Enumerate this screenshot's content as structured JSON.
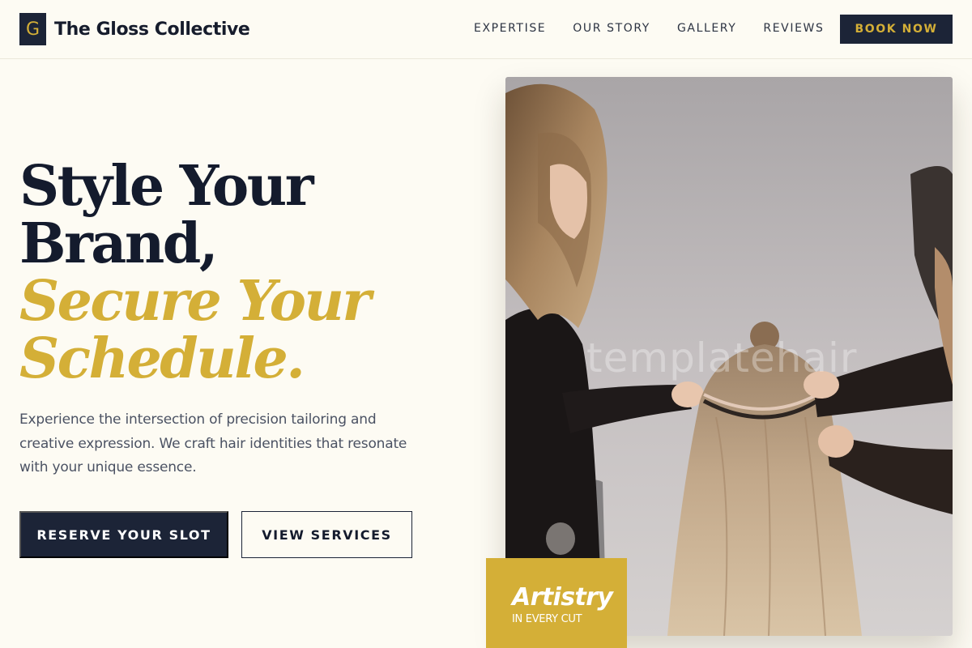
{
  "brand": {
    "logo_letter": "G",
    "name": "The Gloss Collective"
  },
  "nav": {
    "items": [
      {
        "label": "EXPERTISE"
      },
      {
        "label": "OUR STORY"
      },
      {
        "label": "GALLERY"
      },
      {
        "label": "REVIEWS"
      }
    ],
    "cta_label": "BOOK NOW"
  },
  "hero": {
    "headline_line1": "Style Your",
    "headline_line2": "Brand,",
    "headline_line3": "Secure Your",
    "headline_line4": "Schedule.",
    "description": "Experience the intersection of precision tailoring and creative expression. We craft hair identities that resonate with your unique essence.",
    "primary_button": "RESERVE YOUR SLOT",
    "secondary_button": "VIEW SERVICES"
  },
  "photo": {
    "watermark": "templatehair"
  },
  "badge": {
    "title": "Artistry",
    "subtitle": "IN EVERY CUT"
  },
  "colors": {
    "navy": "#1c2437",
    "gold": "#d4af37",
    "cream": "#fdfbf3",
    "body_text": "#4b5263"
  }
}
